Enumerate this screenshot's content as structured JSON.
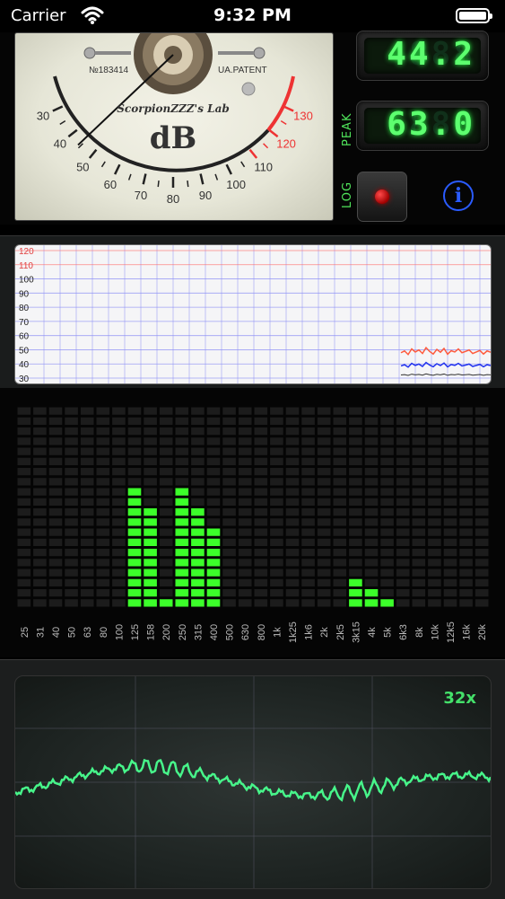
{
  "status_bar": {
    "carrier": "Carrier",
    "time": "9:32 PM"
  },
  "meter": {
    "serial": "№183414",
    "patent": "UA.PATENT",
    "lab_name": "ScorpionZZZ's Lab",
    "unit": "dB",
    "scale_labels": [
      "30",
      "40",
      "50",
      "60",
      "70",
      "80",
      "90",
      "100",
      "110",
      "120",
      "130"
    ],
    "needle_value": 44.2
  },
  "display": {
    "current_value": "44.2",
    "peak_label": "PEAK",
    "peak_value": "63.0",
    "log_label": "LOG",
    "info_symbol": "i"
  },
  "history_graph": {
    "y_labels": [
      "120",
      "110",
      "100",
      "90",
      "80",
      "70",
      "60",
      "50",
      "40",
      "30"
    ],
    "highlight_labels": [
      "120",
      "110"
    ],
    "colors": {
      "grid": "#8a8cf5",
      "limit": "#ff6a6a",
      "peak": "#ff5a3c",
      "avg": "#2233ee",
      "min": "#333333"
    }
  },
  "spectrum": {
    "bands": [
      "25",
      "31",
      "40",
      "50",
      "63",
      "80",
      "100",
      "125",
      "158",
      "200",
      "250",
      "315",
      "400",
      "500",
      "630",
      "800",
      "1k",
      "1k25",
      "1k6",
      "2k",
      "2k5",
      "3k15",
      "4k",
      "5k",
      "6k3",
      "8k",
      "10k",
      "12k5",
      "16k",
      "20k"
    ],
    "levels": [
      0,
      0,
      0,
      0,
      0,
      0,
      0,
      12,
      10,
      1,
      12,
      10,
      8,
      0,
      0,
      0,
      0,
      0,
      0,
      0,
      0,
      3,
      2,
      1,
      0,
      0,
      0,
      0,
      0,
      0
    ],
    "max_level": 20,
    "color_on": "#3cff2a",
    "color_off": "#1c1c1c"
  },
  "oscilloscope": {
    "zoom_label": "32x",
    "trace_color": "#47f58a"
  }
}
